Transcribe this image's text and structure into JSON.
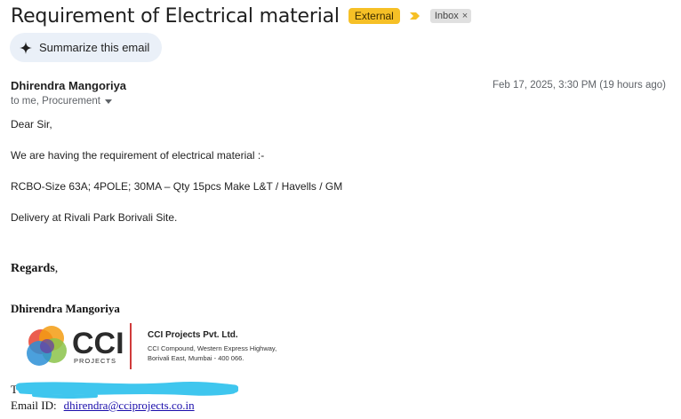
{
  "email": {
    "subject": "Requirement of Electrical material",
    "external_badge": "External",
    "inbox_label": "Inbox",
    "inbox_remove": "×",
    "summarize_label": "Summarize this email",
    "sender_name": "Dhirendra Mangoriya",
    "date": "Feb 17, 2025, 3:30 PM (19 hours ago)",
    "recipients": "to me, Procurement",
    "body": {
      "greeting": "Dear Sir,",
      "line1": "We are having the requirement of electrical material :-",
      "line2": "RCBO-Size 63A; 4POLE; 30MA – Qty 15pcs  Make L&T / Havells / GM",
      "line3": "Delivery at Rivali Park Borivali Site."
    },
    "signature": {
      "regards_bold": "Regards",
      "regards_tail": ",",
      "name": "Dhirendra Mangoriya",
      "logo_text": "CCI",
      "logo_subtext": "PROJECTS",
      "company": "CCI Projects Pvt. Ltd.",
      "address_line1": "CCI Compound, Western Express Highway,",
      "address_line2": "Borivali East, Mumbai - 400 066.",
      "tel_partial": "T",
      "email_label": "Email ID:",
      "email_value": "dhirendra@cciprojects.co.in"
    }
  },
  "colors": {
    "external_badge": "#f6c026",
    "importance_marker": "#f6c026",
    "summarize_bg": "#eaf0f8",
    "redaction": "#3fc6ee",
    "link": "#1a0dab"
  },
  "icons": {
    "importance": "importance-marker-icon",
    "summarize": "sparkle-icon",
    "recipients_toggle": "caret-down-icon"
  }
}
